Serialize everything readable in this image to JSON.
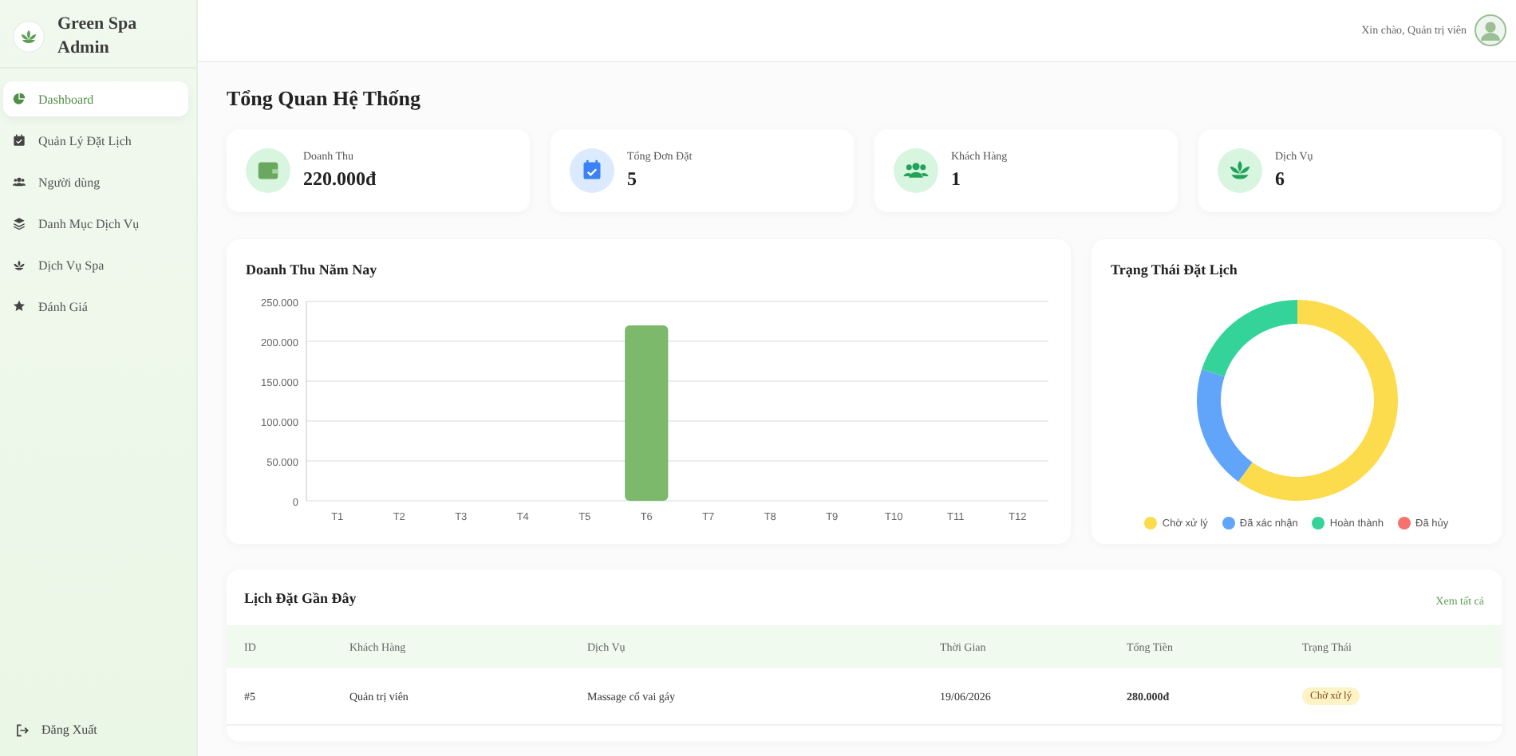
{
  "brand": {
    "name": "Green Spa Admin"
  },
  "sidebar": {
    "items": [
      {
        "label": "Dashboard",
        "selected": true
      },
      {
        "label": "Quản Lý Đặt Lịch",
        "selected": false
      },
      {
        "label": "Người dùng",
        "selected": false
      },
      {
        "label": "Danh Mục Dịch Vụ",
        "selected": false
      },
      {
        "label": "Dịch Vụ Spa",
        "selected": false
      },
      {
        "label": "Đánh Giá",
        "selected": false
      }
    ],
    "logout": "Đăng Xuất"
  },
  "header": {
    "greeting": "Xin chào, Quản trị viên"
  },
  "page_title": "Tổng Quan Hệ Thống",
  "stats": [
    {
      "label": "Doanh Thu",
      "value": "220.000đ"
    },
    {
      "label": "Tổng Đơn Đặt",
      "value": "5"
    },
    {
      "label": "Khách Hàng",
      "value": "1"
    },
    {
      "label": "Dịch Vụ",
      "value": "6"
    }
  ],
  "revenue_chart": {
    "chart_data": {
      "type": "bar",
      "title": "Doanh Thu Năm Nay",
      "categories": [
        "T1",
        "T2",
        "T3",
        "T4",
        "T5",
        "T6",
        "T7",
        "T8",
        "T9",
        "T10",
        "T11",
        "T12"
      ],
      "series": [
        {
          "color": "#7cb96b",
          "values": [
            0,
            0,
            0,
            0,
            0,
            220000,
            0,
            0,
            0,
            0,
            0,
            0
          ]
        }
      ],
      "grid": true,
      "ylim": [
        0,
        250000
      ],
      "yticks": [
        {
          "value": 0,
          "label": "0"
        },
        {
          "value": 50000,
          "label": "50.000"
        },
        {
          "value": 100000,
          "label": "100.000"
        },
        {
          "value": 150000,
          "label": "150.000"
        },
        {
          "value": 200000,
          "label": "200.000"
        },
        {
          "value": 250000,
          "label": "250.000"
        }
      ]
    }
  },
  "status_chart": {
    "chart_data": {
      "type": "donut",
      "title": "Trạng Thái Đặt Lịch",
      "categories": [
        "Chờ xử lý",
        "Đã xác nhận",
        "Hoàn thành",
        "Đã hủy"
      ],
      "values": [
        60,
        20,
        20,
        0
      ],
      "legend": true,
      "colors": [
        "#fcdc4d",
        "#60a5fa",
        "#34d399",
        "#f87171"
      ]
    }
  },
  "recent": {
    "title": "Lịch Đặt Gần Đây",
    "view_all": "Xem tất cả",
    "columns": [
      "ID",
      "Khách Hàng",
      "Dịch Vụ",
      "Thời Gian",
      "Tổng Tiền",
      "Trạng Thái"
    ],
    "rows": [
      {
        "id": "#5",
        "customer": "Quản trị viên",
        "service": "Massage cổ vai gáy",
        "date": "19/06/2026",
        "total": "280.000đ",
        "status": "Chờ xử lý",
        "color": "#fef3c7"
      }
    ]
  }
}
